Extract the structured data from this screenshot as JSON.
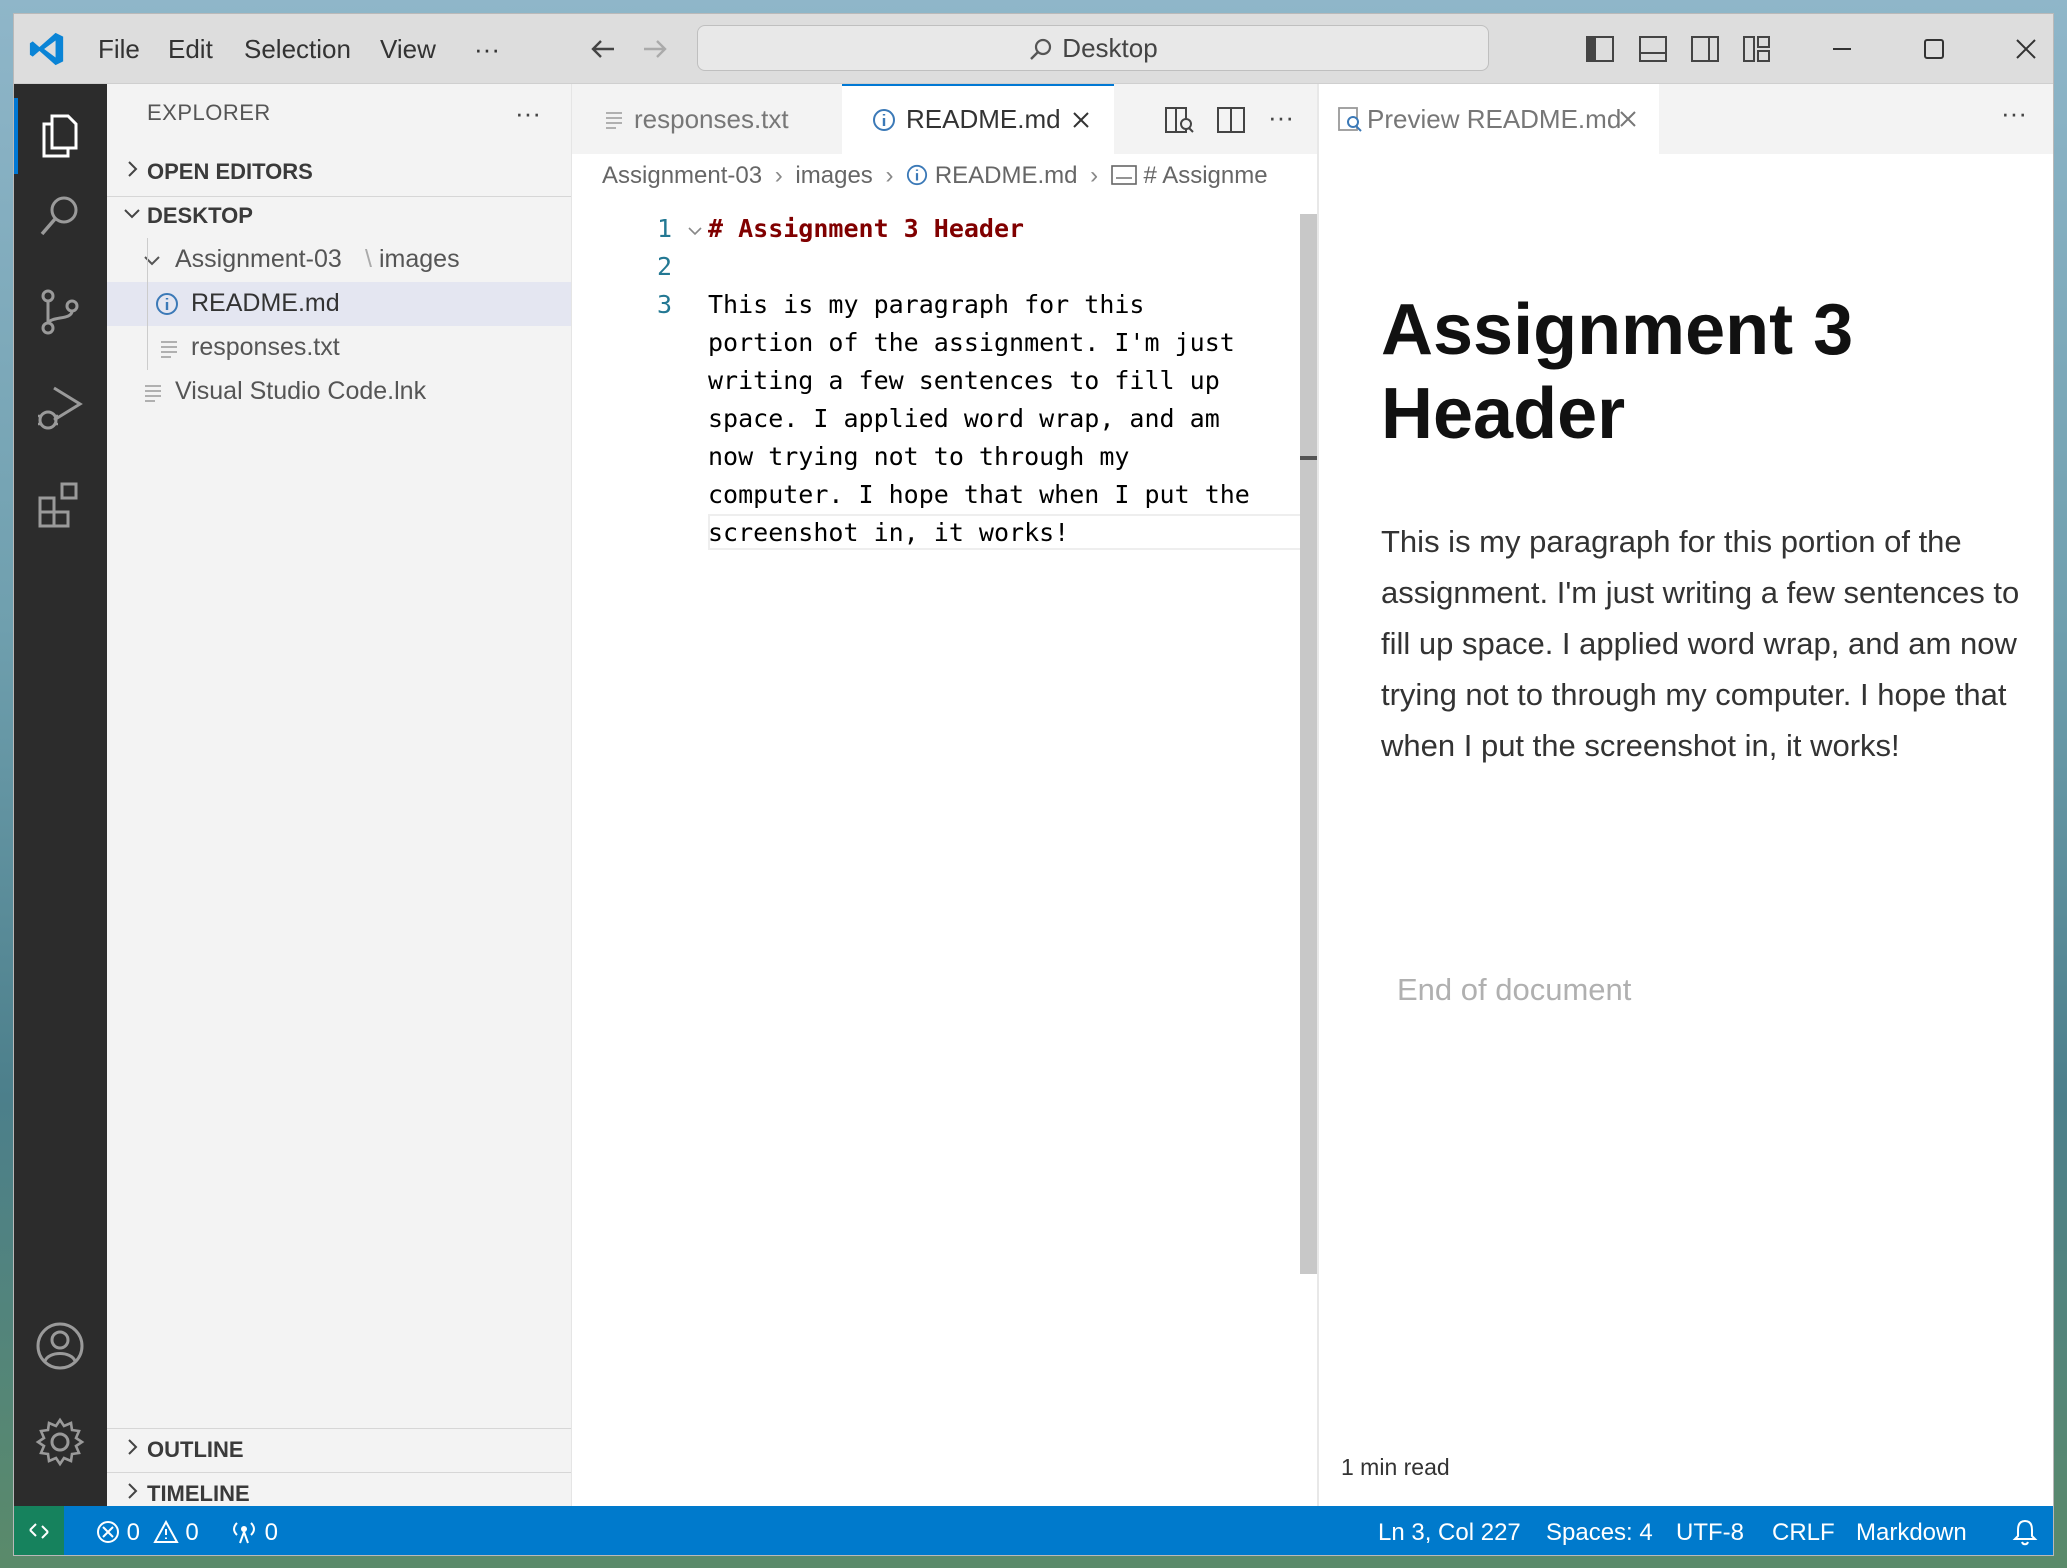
{
  "titlebar": {
    "menus": [
      "File",
      "Edit",
      "Selection",
      "View",
      "···"
    ],
    "search_text": "Desktop"
  },
  "sidebar": {
    "title": "EXPLORER",
    "more": "···",
    "sections": {
      "open_editors": "OPEN EDITORS",
      "desktop": "DESKTOP",
      "outline": "OUTLINE",
      "timeline": "TIMELINE"
    },
    "tree": {
      "folder_a": "Assignment-03",
      "folder_sep": "\\",
      "folder_b": "images",
      "file1": "README.md",
      "file2": "responses.txt",
      "file3": "Visual Studio Code.lnk"
    }
  },
  "editor": {
    "tabs": [
      "responses.txt",
      "README.md"
    ],
    "more": "···",
    "breadcrumb": {
      "part1": "Assignment-03",
      "part2": "images",
      "part3": "README.md",
      "part4": "# Assignme"
    },
    "line_numbers": [
      "1",
      "2",
      "3"
    ],
    "heading_line": "# Assignment 3 Header",
    "paragraph_lines": [
      "This is my paragraph for this",
      "portion of the assignment. I'm just",
      "writing a few sentences to fill up",
      "space. I applied word wrap, and am",
      "now trying not to through my",
      "computer. I hope that when I put the",
      "screenshot in, it works!"
    ]
  },
  "preview": {
    "tab": "Preview README.md",
    "more": "···",
    "heading": "Assignment 3 Header",
    "paragraph": "This is my paragraph for this portion of the assignment. I'm just writing a few sentences to fill up space. I applied word wrap, and am now trying not to through my computer. I hope that when I put the screenshot in, it works!",
    "end_text": "End of document",
    "read_time": "1 min read"
  },
  "status": {
    "errors": "0",
    "warnings": "0",
    "ports": "0",
    "position": "Ln 3, Col 227",
    "spaces": "Spaces: 4",
    "encoding": "UTF-8",
    "eol": "CRLF",
    "language": "Markdown"
  },
  "colors": {
    "accent": "#0078d4",
    "statusbar": "#007acc",
    "remote": "#16825d",
    "heading_code": "#800000"
  }
}
